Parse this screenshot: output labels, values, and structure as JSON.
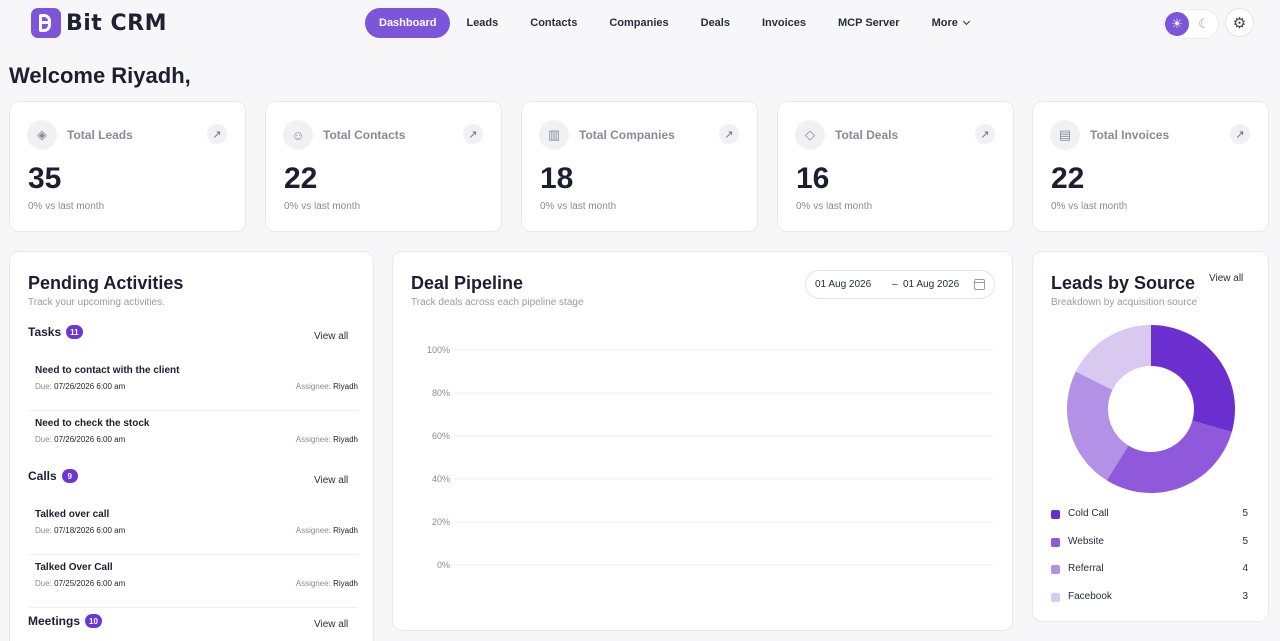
{
  "app": {
    "name": "Bit CRM"
  },
  "nav": {
    "items": [
      {
        "label": "Dashboard",
        "active": true
      },
      {
        "label": "Leads"
      },
      {
        "label": "Contacts"
      },
      {
        "label": "Companies"
      },
      {
        "label": "Deals"
      },
      {
        "label": "Invoices"
      },
      {
        "label": "MCP Server"
      },
      {
        "label": "More"
      }
    ]
  },
  "welcome": "Welcome Riyadh,",
  "stats": [
    {
      "label": "Total Leads",
      "value": "35",
      "sub": "0%  vs last month",
      "icon": "leads-icon"
    },
    {
      "label": "Total Contacts",
      "value": "22",
      "sub": "0%  vs last month",
      "icon": "user-icon"
    },
    {
      "label": "Total Companies",
      "value": "18",
      "sub": "0%  vs last month",
      "icon": "building-icon"
    },
    {
      "label": "Total Deals",
      "value": "16",
      "sub": "0%  vs last month",
      "icon": "handshake-icon"
    },
    {
      "label": "Total Invoices",
      "value": "22",
      "sub": "0%  vs last month",
      "icon": "invoice-icon"
    }
  ],
  "pending": {
    "title": "Pending Activities",
    "subtitle": "Track your upcoming activities.",
    "view_all": "View all",
    "tasks": {
      "label": "Tasks",
      "count": "11",
      "items": [
        {
          "title": "Need to contact with the client",
          "due_label": "Due: ",
          "due": "07/26/2026 6:00 am",
          "assignee_label": "Assignee: ",
          "assignee": "Riyadh"
        },
        {
          "title": "Need to check the stock",
          "due_label": "Due: ",
          "due": "07/26/2026 6:00 am",
          "assignee_label": "Assignee: ",
          "assignee": "Riyadh"
        }
      ]
    },
    "calls": {
      "label": "Calls",
      "count": "9",
      "items": [
        {
          "title": "Talked over call",
          "due_label": "Due: ",
          "due": "07/18/2026 6:00 am",
          "assignee_label": "Assignee: ",
          "assignee": "Riyadh"
        },
        {
          "title": "Talked Over Call",
          "due_label": "Due: ",
          "due": "07/25/2026 6:00 am",
          "assignee_label": "Assignee: ",
          "assignee": "Riyadh"
        }
      ]
    },
    "meetings": {
      "label": "Meetings",
      "count": "10"
    }
  },
  "pipeline": {
    "title": "Deal Pipeline",
    "subtitle": "Track deals across each pipeline stage",
    "date_from": "01 Aug 2026",
    "date_sep": "–",
    "date_to": "01 Aug 2026"
  },
  "sources": {
    "title": "Leads by Source",
    "subtitle": "Breakdown by acquisition source",
    "view_all": "View all"
  },
  "chart_data": [
    {
      "type": "bar",
      "title": "Deal Pipeline",
      "categories": [],
      "values": [],
      "yticks": [
        "100%",
        "80%",
        "60%",
        "40%",
        "20%",
        "0%"
      ],
      "ylim": [
        0,
        100
      ],
      "grid": true
    },
    {
      "type": "pie",
      "title": "Leads by Source",
      "donut": true,
      "categories": [
        "Cold Call",
        "Website",
        "Referral",
        "Facebook"
      ],
      "values": [
        5,
        5,
        4,
        3
      ],
      "colors": [
        "#6b2fd0",
        "#9059db",
        "#b391e6",
        "#d9c9f1"
      ],
      "legend": "bottom"
    }
  ]
}
